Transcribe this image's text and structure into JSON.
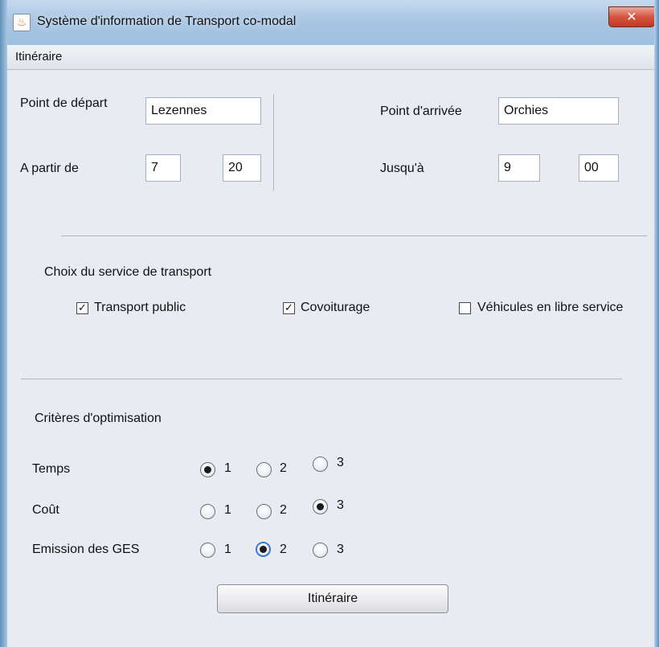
{
  "window": {
    "title": "Système d'information de Transport co-modal",
    "close_label": "✕"
  },
  "menu": {
    "items": [
      "Itinéraire"
    ]
  },
  "form": {
    "depart_label": "Point de départ",
    "depart_value": "Lezennes",
    "arrivee_label": "Point d'arrivée",
    "arrivee_value": "Orchies",
    "from_label": "A partir de",
    "from_hour": "7",
    "from_min": "20",
    "until_label": "Jusqu'à",
    "until_hour": "9",
    "until_min": "00"
  },
  "services": {
    "heading": "Choix du service de transport",
    "options": [
      {
        "label": "Transport public",
        "checked": true
      },
      {
        "label": "Covoiturage",
        "checked": true
      },
      {
        "label": "Véhicules en libre service",
        "checked": false
      }
    ]
  },
  "criteria": {
    "heading": "Critères d'optimisation",
    "choices": [
      "1",
      "2",
      "3"
    ],
    "rows": [
      {
        "label": "Temps",
        "selected": 1
      },
      {
        "label": "Coût",
        "selected": 3
      },
      {
        "label": "Emission des GES",
        "selected": 2
      }
    ]
  },
  "button": {
    "label": "Itinéraire"
  }
}
